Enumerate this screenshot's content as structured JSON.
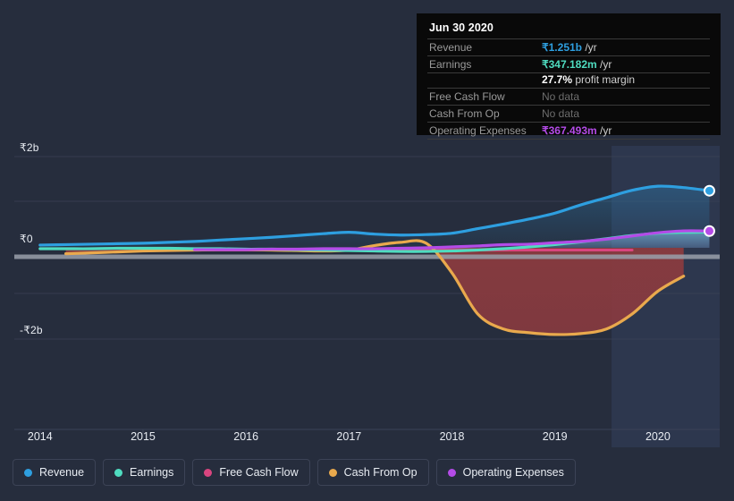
{
  "tooltip": {
    "title": "Jun 30 2020",
    "rows": [
      {
        "label": "Revenue",
        "value": "₹1.251b",
        "unit": "/yr",
        "color": "#2e9fe0",
        "nodata": false
      },
      {
        "label": "Earnings",
        "value": "₹347.182m",
        "unit": "/yr",
        "color": "#4fdcc0",
        "nodata": false
      },
      {
        "label": "",
        "value": "27.7%",
        "unit": "profit margin",
        "color": "#ffffff",
        "nodata": false,
        "sub": true
      },
      {
        "label": "Free Cash Flow",
        "value": "No data",
        "unit": "",
        "color": "#6d6d6d",
        "nodata": true
      },
      {
        "label": "Cash From Op",
        "value": "No data",
        "unit": "",
        "color": "#6d6d6d",
        "nodata": true
      },
      {
        "label": "Operating Expenses",
        "value": "₹367.493m",
        "unit": "/yr",
        "color": "#b44be8",
        "nodata": false
      }
    ]
  },
  "legend": {
    "items": [
      {
        "label": "Revenue",
        "color": "#2e9fe0"
      },
      {
        "label": "Earnings",
        "color": "#4fdcc0"
      },
      {
        "label": "Free Cash Flow",
        "color": "#d9457f"
      },
      {
        "label": "Cash From Op",
        "color": "#e9a94d"
      },
      {
        "label": "Operating Expenses",
        "color": "#b44be8"
      }
    ]
  },
  "axes": {
    "y_ticks": [
      {
        "label": "₹2b",
        "value": 2
      },
      {
        "label": "₹0",
        "value": 0
      },
      {
        "label": "-₹2b",
        "value": -2
      }
    ],
    "x_ticks": [
      "2014",
      "2015",
      "2016",
      "2017",
      "2018",
      "2019",
      "2020"
    ]
  },
  "colors": {
    "background": "#262d3d",
    "grid": "#3a4256",
    "zero_line": "#9aa0ab",
    "revenue": "#2e9fe0",
    "earnings": "#4fdcc0",
    "free_cash_flow": "#d9457f",
    "cash_from_op": "#e9a94d",
    "operating_expenses": "#b44be8",
    "negative_fill": "#8d3b3f",
    "forecast_band": "#2c3750"
  },
  "chart_data": {
    "type": "area",
    "title": "",
    "xlabel": "",
    "ylabel": "",
    "currency": "INR",
    "unit": "billions",
    "xlim": [
      2013.75,
      2020.6
    ],
    "ylim": [
      -2.3,
      2.15
    ],
    "grid": true,
    "legend_position": "bottom",
    "forecast_divider_x": 2019.55,
    "x": [
      2014.0,
      2014.25,
      2014.5,
      2014.75,
      2015.0,
      2015.25,
      2015.5,
      2015.75,
      2016.0,
      2016.25,
      2016.5,
      2016.75,
      2017.0,
      2017.25,
      2017.5,
      2017.75,
      2018.0,
      2018.25,
      2018.5,
      2018.75,
      2019.0,
      2019.25,
      2019.5,
      2019.75,
      2020.0,
      2020.25,
      2020.5
    ],
    "series": [
      {
        "name": "Revenue",
        "color": "#2e9fe0",
        "values": [
          0.06,
          0.07,
          0.08,
          0.09,
          0.1,
          0.12,
          0.14,
          0.17,
          0.2,
          0.23,
          0.27,
          0.31,
          0.34,
          0.3,
          0.28,
          0.29,
          0.32,
          0.42,
          0.52,
          0.63,
          0.76,
          0.94,
          1.1,
          1.26,
          1.35,
          1.32,
          1.251
        ]
      },
      {
        "name": "Earnings",
        "color": "#4fdcc0",
        "values": [
          -0.02,
          -0.02,
          -0.02,
          -0.01,
          -0.01,
          -0.01,
          -0.02,
          -0.02,
          -0.03,
          -0.03,
          -0.04,
          -0.05,
          -0.06,
          -0.07,
          -0.08,
          -0.08,
          -0.07,
          -0.05,
          -0.02,
          0.02,
          0.07,
          0.13,
          0.2,
          0.27,
          0.32,
          0.34,
          0.347182
        ]
      },
      {
        "name": "Free Cash Flow",
        "color": "#d9457f",
        "values": [
          null,
          null,
          null,
          null,
          null,
          null,
          -0.05,
          -0.05,
          -0.05,
          -0.05,
          -0.06,
          -0.06,
          -0.06,
          -0.05,
          -0.05,
          -0.05,
          -0.05,
          -0.05,
          -0.05,
          -0.05,
          -0.05,
          -0.05,
          -0.05,
          -0.05,
          null,
          null,
          null
        ]
      },
      {
        "name": "Cash From Op",
        "color": "#e9a94d",
        "values": [
          null,
          -0.13,
          -0.11,
          -0.09,
          -0.07,
          -0.06,
          -0.05,
          -0.04,
          -0.04,
          -0.05,
          -0.06,
          -0.07,
          -0.05,
          0.05,
          0.12,
          0.1,
          -0.55,
          -1.45,
          -1.78,
          -1.86,
          -1.9,
          -1.88,
          -1.78,
          -1.45,
          -0.95,
          -0.62,
          null
        ]
      },
      {
        "name": "Operating Expenses",
        "color": "#b44be8",
        "values": [
          null,
          null,
          null,
          null,
          null,
          null,
          -0.04,
          -0.04,
          -0.04,
          -0.03,
          -0.03,
          -0.02,
          -0.02,
          -0.02,
          -0.01,
          0.0,
          0.02,
          0.04,
          0.07,
          0.08,
          0.11,
          0.14,
          0.19,
          0.26,
          0.33,
          0.37,
          0.367493
        ]
      }
    ],
    "endpoints": [
      {
        "name": "Revenue",
        "x": 2020.5,
        "y": 1.251,
        "color": "#2e9fe0"
      },
      {
        "name": "Operating Expenses",
        "x": 2020.5,
        "y": 0.367493,
        "color": "#b44be8"
      }
    ]
  }
}
